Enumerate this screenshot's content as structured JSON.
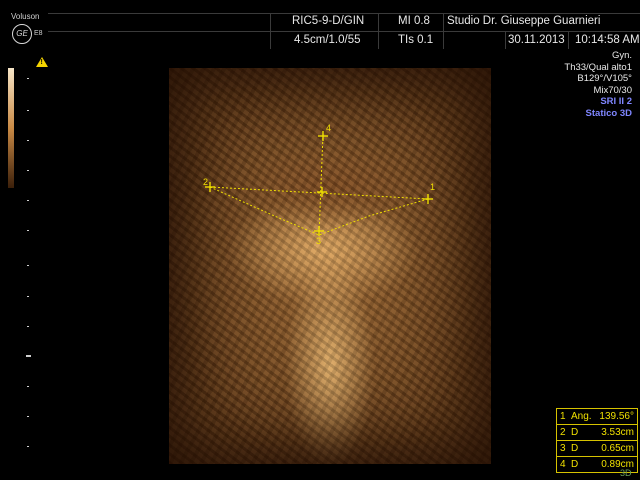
{
  "header": {
    "brand": "Voluson",
    "logo": "GE",
    "model": "E8",
    "probe": "RIC5-9-D/GIN",
    "mi": "MI  0.8",
    "clinic": "Studio Dr. Giuseppe Guarnieri",
    "depth": "4.5cm/1.0/55",
    "tis": "TIs  0.1",
    "date": "30.11.2013",
    "time": "10:14:58 AM"
  },
  "right_panel": {
    "lines": [
      "Gyn.",
      "Th33/Qual alto1",
      "B129°/V105°",
      "Mix70/30"
    ],
    "blue_lines": [
      "SRI II 2",
      "Statico 3D"
    ]
  },
  "markers": [
    {
      "label": "1"
    },
    {
      "label": "2"
    },
    {
      "label": "3"
    },
    {
      "label": "4"
    }
  ],
  "measurements": [
    {
      "num": "1",
      "key": "Ang.",
      "value": "139.56°"
    },
    {
      "num": "2",
      "key": "D",
      "value": "3.53cm"
    },
    {
      "num": "3",
      "key": "D",
      "value": "0.65cm"
    },
    {
      "num": "4",
      "key": "D",
      "value": "0.89cm"
    }
  ],
  "footer_mode": "3D",
  "colors": {
    "caliper": "#f0e000",
    "accent_blue": "#7f86ff",
    "warning": "#f5d400"
  },
  "icons": {
    "warning": "warning-triangle-icon",
    "logo": "ge-logo-icon"
  }
}
